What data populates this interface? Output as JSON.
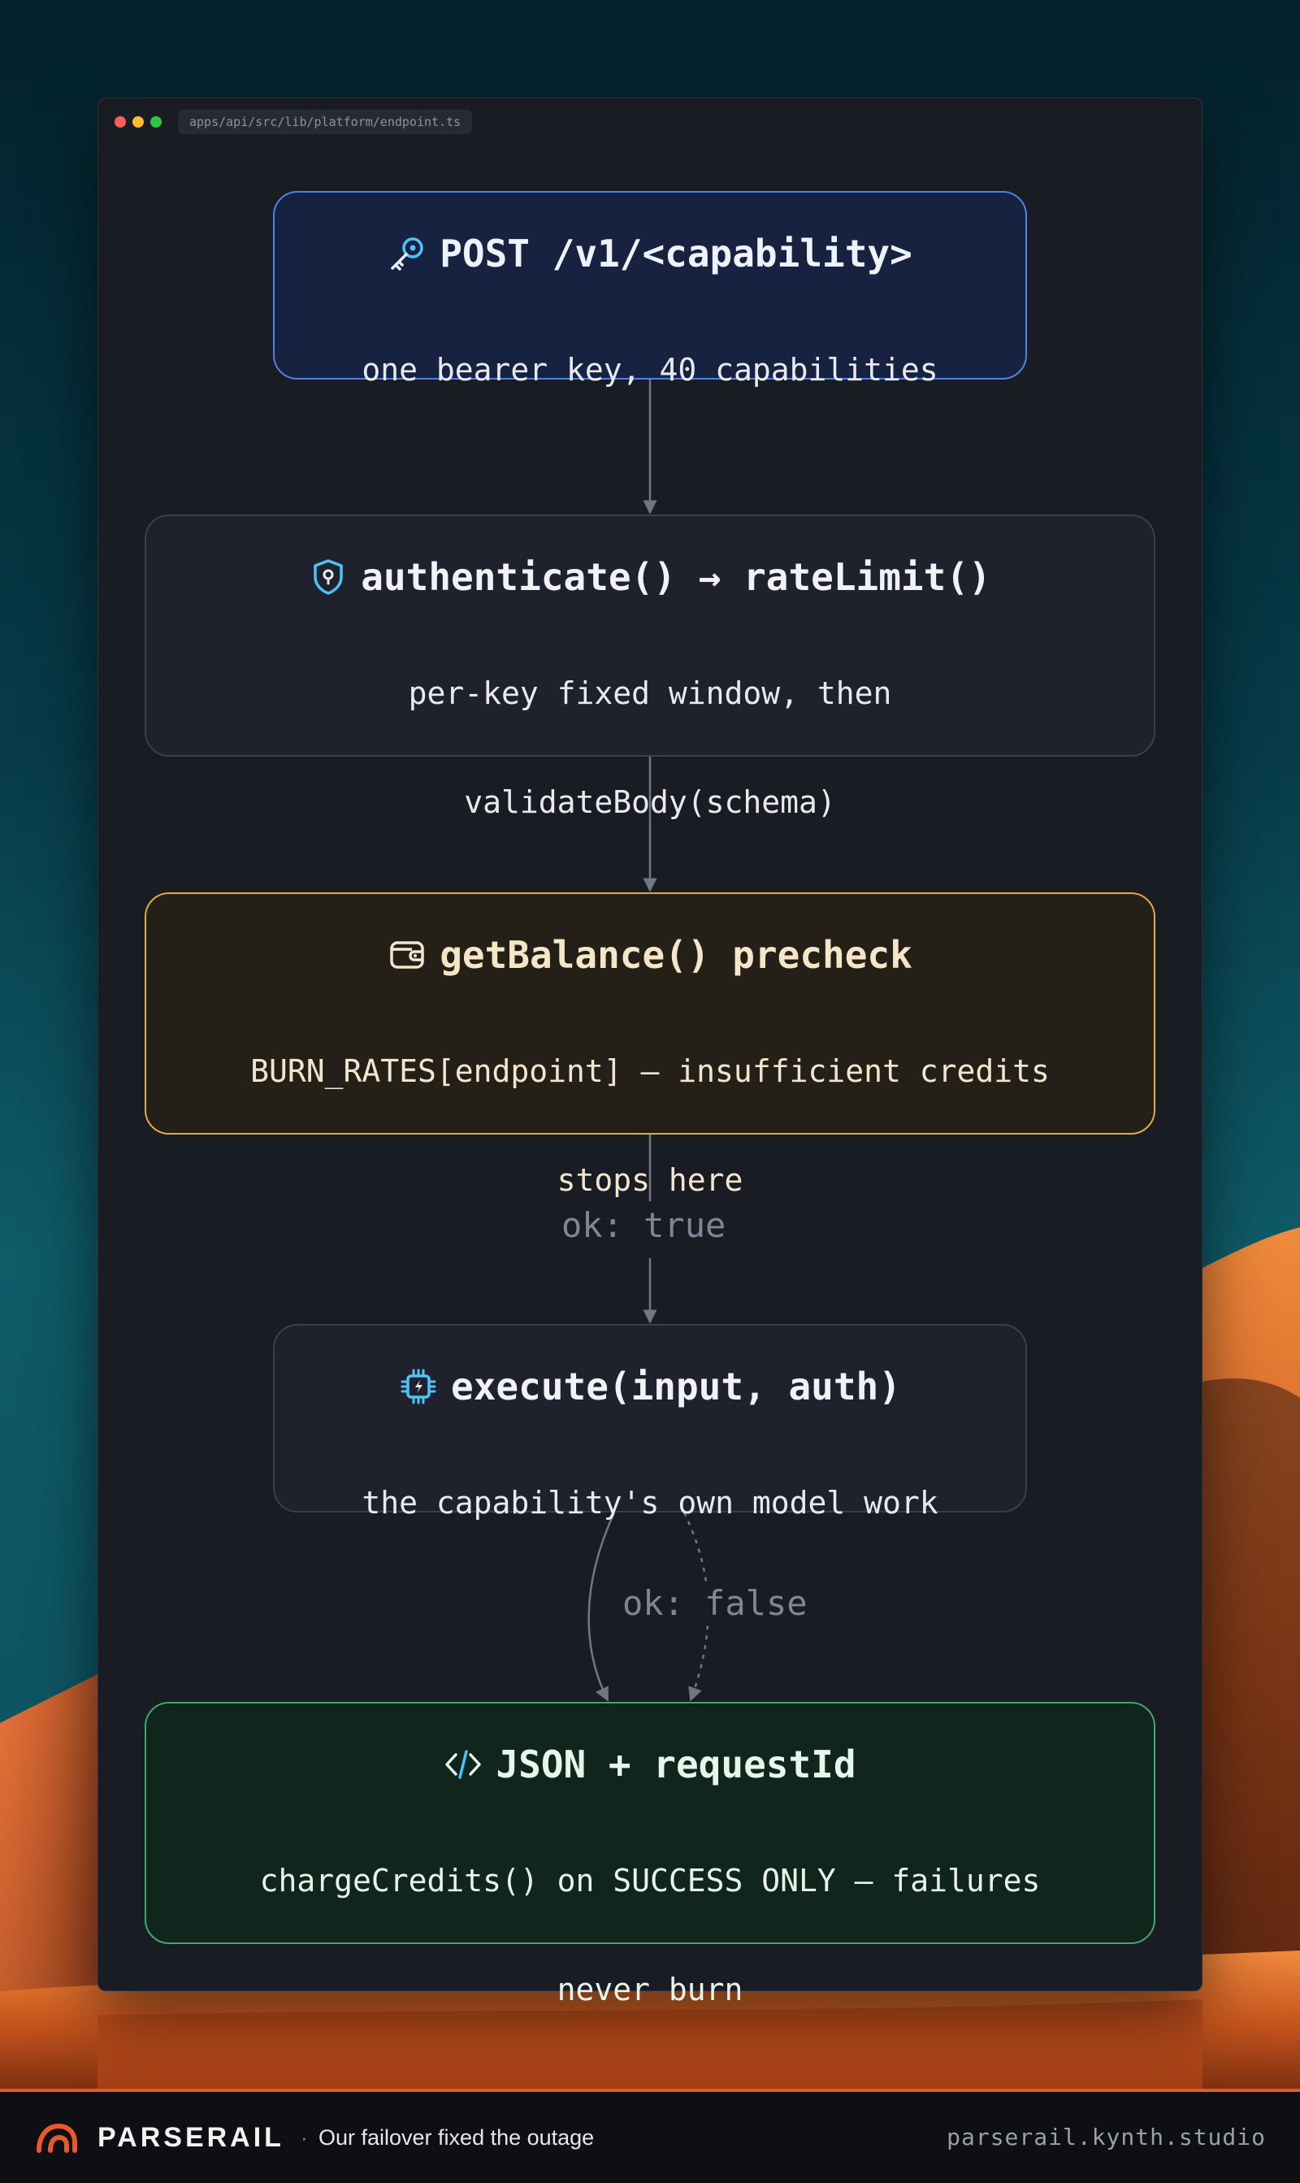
{
  "window": {
    "file_path": "apps/api/src/lib/platform/endpoint.ts"
  },
  "flow": {
    "nodes": [
      {
        "id": "request",
        "icon": "key-icon",
        "title": "POST /v1/<capability>",
        "lines": [
          "one bearer key, 40 capabilities"
        ]
      },
      {
        "id": "auth",
        "icon": "shield-icon",
        "title": "authenticate() → rateLimit()",
        "lines": [
          "per-key fixed window, then",
          "validateBody(schema)"
        ]
      },
      {
        "id": "precheck",
        "icon": "wallet-icon",
        "title": "getBalance() precheck",
        "lines": [
          "BURN_RATES[endpoint] — insufficient credits",
          "stops here"
        ]
      },
      {
        "id": "execute",
        "icon": "chip-icon",
        "title": "execute(input, auth)",
        "lines": [
          "the capability's own model work"
        ]
      },
      {
        "id": "response",
        "icon": "code-icon",
        "title": "JSON + requestId",
        "lines": [
          "chargeCredits() on SUCCESS ONLY — failures",
          "never burn"
        ]
      }
    ],
    "edges": [
      {
        "from": "request",
        "to": "auth",
        "label": ""
      },
      {
        "from": "auth",
        "to": "precheck",
        "label": ""
      },
      {
        "from": "precheck",
        "to": "execute",
        "label": "ok: true"
      },
      {
        "from": "execute",
        "to": "response",
        "label": ""
      },
      {
        "from": "execute",
        "to": "response",
        "label": "ok: false",
        "style": "dotted"
      }
    ]
  },
  "footer": {
    "brand": "PARSERAIL",
    "separator": "·",
    "tagline": "Our failover fixed the outage",
    "site": "parserail.kynth.studio"
  },
  "colors": {
    "accent": "#e8592a",
    "request_border": "#4f82e8",
    "precheck_border": "#e0a94a",
    "response_border": "#3caa6e",
    "icon_cyan": "#4fc3f7"
  }
}
